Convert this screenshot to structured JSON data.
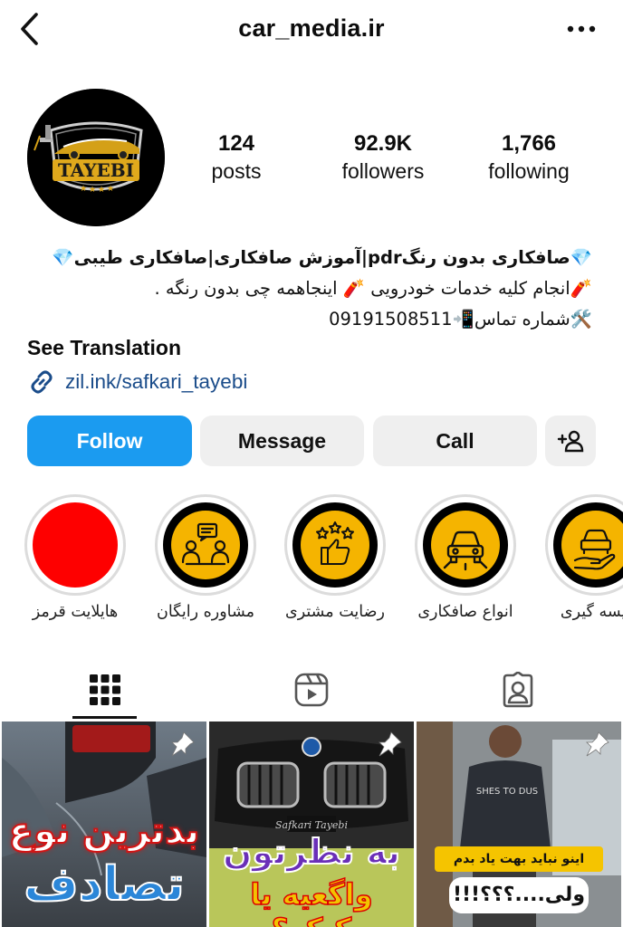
{
  "header": {
    "username": "car_media.ir"
  },
  "avatar": {
    "brand": "TAYEBI"
  },
  "stats": [
    {
      "value": "124",
      "label": "posts"
    },
    {
      "value": "92.9K",
      "label": "followers"
    },
    {
      "value": "1,766",
      "label": "following"
    }
  ],
  "bio": {
    "line1": "💎صافکاری بدون رنگpdr|آموزش صافکاری|صافکاری طیبی💎",
    "line2": "🧨انجام کلیه خدمات خودرویی 🧨 اینجاهمه چی بدون رنگه .",
    "line3": "🛠️شماره تماس📲09191508511",
    "see_translation": "See Translation",
    "link": "zil.ink/safkari_tayebi"
  },
  "actions": {
    "follow": "Follow",
    "message": "Message",
    "call": "Call"
  },
  "highlights": [
    {
      "label": "هایلایت قرمز",
      "icon": "red-circle",
      "color": "#fe0000"
    },
    {
      "label": "مشاوره رایگان",
      "icon": "consultation-icon",
      "color": "#f5b400"
    },
    {
      "label": "رضایت مشتری",
      "icon": "thumbs-up-stars-icon",
      "color": "#f5b400"
    },
    {
      "label": "انواع صافکاری",
      "icon": "car-front-icon",
      "color": "#f5b400"
    },
    {
      "label": "لیسه گیری",
      "icon": "car-hand-icon",
      "color": "#f5b400"
    }
  ],
  "posts": [
    {
      "line1": "بدترین نوع",
      "line2": "تصادف"
    },
    {
      "line1": "به نظرتون",
      "line2": "واگعیه یا کیکه؟",
      "caption": "Safkari Tayebi"
    },
    {
      "banner": "اینو نباید بهت یاد بدم",
      "line2": "ولی....؟؟؟!!!"
    }
  ],
  "colors": {
    "accent": "#1b9bf0",
    "link": "#1a4c8a",
    "button_bg": "#efefef",
    "gold": "#f5b400"
  }
}
